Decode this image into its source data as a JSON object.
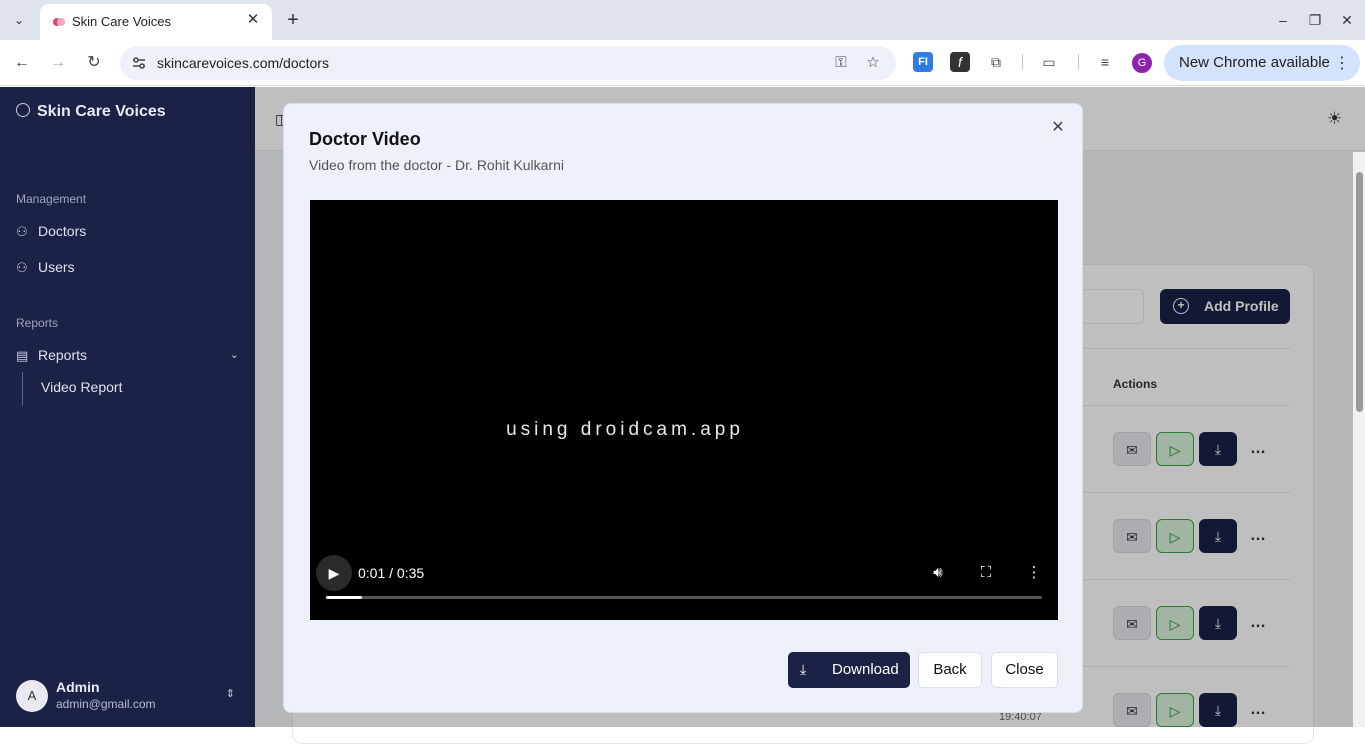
{
  "browser": {
    "tab_title": "Skin Care Voices",
    "url": "skincarevoices.com/doctors",
    "new_chrome_label": "New Chrome available",
    "profile_initial": "G"
  },
  "sidebar": {
    "brand": "Skin Care Voices",
    "sections": [
      {
        "title": "Management",
        "items": [
          {
            "label": "Doctors",
            "icon": "users-icon"
          },
          {
            "label": "Users",
            "icon": "users-icon"
          }
        ]
      },
      {
        "title": "Reports",
        "items": [
          {
            "label": "Reports",
            "icon": "report-icon"
          },
          {
            "label": "Video Report",
            "icon": ""
          }
        ]
      }
    ],
    "user": {
      "initial": "A",
      "name": "Admin",
      "email": "admin@gmail.com"
    }
  },
  "main": {
    "add_profile_label": "Add Profile",
    "actions_header": "Actions",
    "last_row_time": "19:40:07"
  },
  "dialog": {
    "title": "Doctor Video",
    "subtitle": "Video from the doctor - Dr. Rohit Kulkarni",
    "video": {
      "watermark": "using droidcam.app",
      "time_display": "0:01 / 0:35",
      "progress_fraction": 0.05
    },
    "buttons": {
      "download": "Download",
      "back": "Back",
      "close": "Close"
    }
  },
  "colors": {
    "sidebar_bg": "#1a2246",
    "primary": "#1a2246",
    "play_accent": "#3aa24a"
  }
}
